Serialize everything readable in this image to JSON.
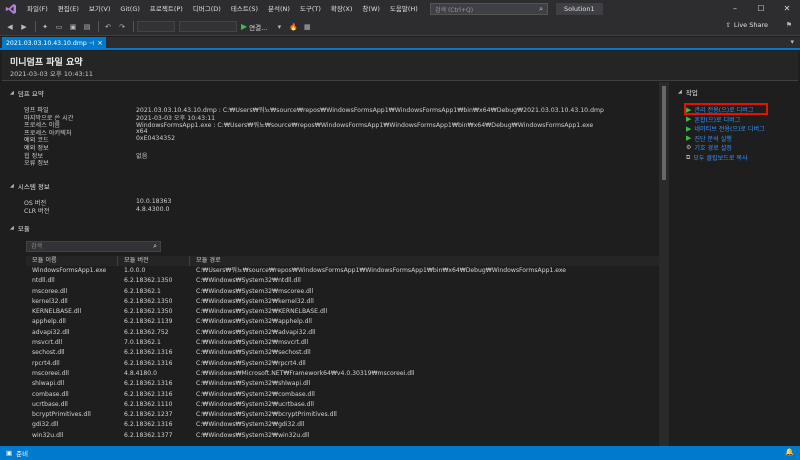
{
  "menu": [
    "파일(F)",
    "편집(E)",
    "보기(V)",
    "Git(G)",
    "프로젝트(P)",
    "디버그(D)",
    "테스트(S)",
    "분석(N)",
    "도구(T)",
    "확장(X)",
    "창(W)",
    "도움말(H)"
  ],
  "search": {
    "placeholder": "검색 (Ctrl+Q)"
  },
  "solution_name": "Solution1",
  "toolbar": {
    "run_label": "연결...",
    "live_share": "Live Share"
  },
  "tab": {
    "title": "2021.03.03.10.43.10.dmp"
  },
  "header": {
    "title": "미니덤프 파일 요약",
    "subtitle": "2021-03-03 오후 10:43:11"
  },
  "dump_summary": {
    "heading": "덤프 요약",
    "rows": [
      {
        "key": "덤프 파일",
        "value": "2021.03.03.10.43.10.dmp : C:₩Users₩워뇨₩source₩repos₩WindowsFormsApp1₩WindowsFormsApp1₩bin₩x64₩Debug₩2021.03.03.10.43.10.dmp"
      },
      {
        "key": "마지막으로 쓴 시간",
        "value": "2021-03-03 오후 10:43:11"
      },
      {
        "key": "프로세스 이름",
        "value": "WindowsFormsApp1.exe : C:₩Users₩워뇨₩source₩repos₩WindowsFormsApp1₩WindowsFormsApp1₩bin₩x64₩Debug₩WindowsFormsApp1.exe"
      },
      {
        "key": "프로세스 아키텍처",
        "value": "x64"
      },
      {
        "key": "예외 코드",
        "value": "0xE0434352"
      },
      {
        "key": "예외 정보",
        "value": ""
      },
      {
        "key": "힙 정보",
        "value": "없음"
      },
      {
        "key": "오류 정보",
        "value": ""
      }
    ]
  },
  "system_info": {
    "heading": "시스템 정보",
    "rows": [
      {
        "key": "OS 버전",
        "value": "10.0.18363"
      },
      {
        "key": "CLR 버전",
        "value": "4.8.4300.0"
      }
    ]
  },
  "modules": {
    "heading": "모듈",
    "search_placeholder": "검색",
    "columns": [
      "모듈 이름",
      "모듈 버전",
      "모듈 경로"
    ],
    "rows": [
      [
        "WindowsFormsApp1.exe",
        "1.0.0.0",
        "C:₩Users₩워뇨₩source₩repos₩WindowsFormsApp1₩WindowsFormsApp1₩bin₩x64₩Debug₩WindowsFormsApp1.exe"
      ],
      [
        "ntdll.dll",
        "6.2.18362.1350",
        "C:₩Windows₩System32₩ntdll.dll"
      ],
      [
        "mscoree.dll",
        "6.2.18362.1",
        "C:₩Windows₩System32₩mscoree.dll"
      ],
      [
        "kernel32.dll",
        "6.2.18362.1350",
        "C:₩Windows₩System32₩kernel32.dll"
      ],
      [
        "KERNELBASE.dll",
        "6.2.18362.1350",
        "C:₩Windows₩System32₩KERNELBASE.dll"
      ],
      [
        "apphelp.dll",
        "6.2.18362.1139",
        "C:₩Windows₩System32₩apphelp.dll"
      ],
      [
        "advapi32.dll",
        "6.2.18362.752",
        "C:₩Windows₩System32₩advapi32.dll"
      ],
      [
        "msvcrt.dll",
        "7.0.18362.1",
        "C:₩Windows₩System32₩msvcrt.dll"
      ],
      [
        "sechost.dll",
        "6.2.18362.1316",
        "C:₩Windows₩System32₩sechost.dll"
      ],
      [
        "rpcrt4.dll",
        "6.2.18362.1316",
        "C:₩Windows₩System32₩rpcrt4.dll"
      ],
      [
        "mscoreei.dll",
        "4.8.4180.0",
        "C:₩Windows₩Microsoft.NET₩Framework64₩v4.0.30319₩mscoreei.dll"
      ],
      [
        "shlwapi.dll",
        "6.2.18362.1316",
        "C:₩Windows₩System32₩shlwapi.dll"
      ],
      [
        "combase.dll",
        "6.2.18362.1316",
        "C:₩Windows₩System32₩combase.dll"
      ],
      [
        "ucrtbase.dll",
        "6.2.18362.1110",
        "C:₩Windows₩System32₩ucrtbase.dll"
      ],
      [
        "bcryptPrimitives.dll",
        "6.2.18362.1237",
        "C:₩Windows₩System32₩bcryptPrimitives.dll"
      ],
      [
        "gdi32.dll",
        "6.2.18362.1316",
        "C:₩Windows₩System32₩gdi32.dll"
      ],
      [
        "win32u.dll",
        "6.2.18362.1377",
        "C:₩Windows₩System32₩win32u.dll"
      ]
    ]
  },
  "actions": {
    "heading": "작업",
    "items": [
      {
        "label": "관리 전용(으)로 디버그",
        "icon": "play-icon"
      },
      {
        "label": "혼합(으)로 디버그",
        "icon": "play-icon"
      },
      {
        "label": "네이티브 전용(으)로 디버그",
        "icon": "play-icon"
      },
      {
        "label": "진단 분석 실행",
        "icon": "play-icon"
      },
      {
        "label": "기호 경로 설정",
        "icon": "settings-icon"
      },
      {
        "label": "모두 클립보드로 복사",
        "icon": "copy-icon"
      }
    ]
  },
  "status": {
    "text": "준비"
  },
  "colors": {
    "accent": "#007acc",
    "link": "#3794ff",
    "highlight": "#e51400",
    "play": "#3fb950"
  }
}
